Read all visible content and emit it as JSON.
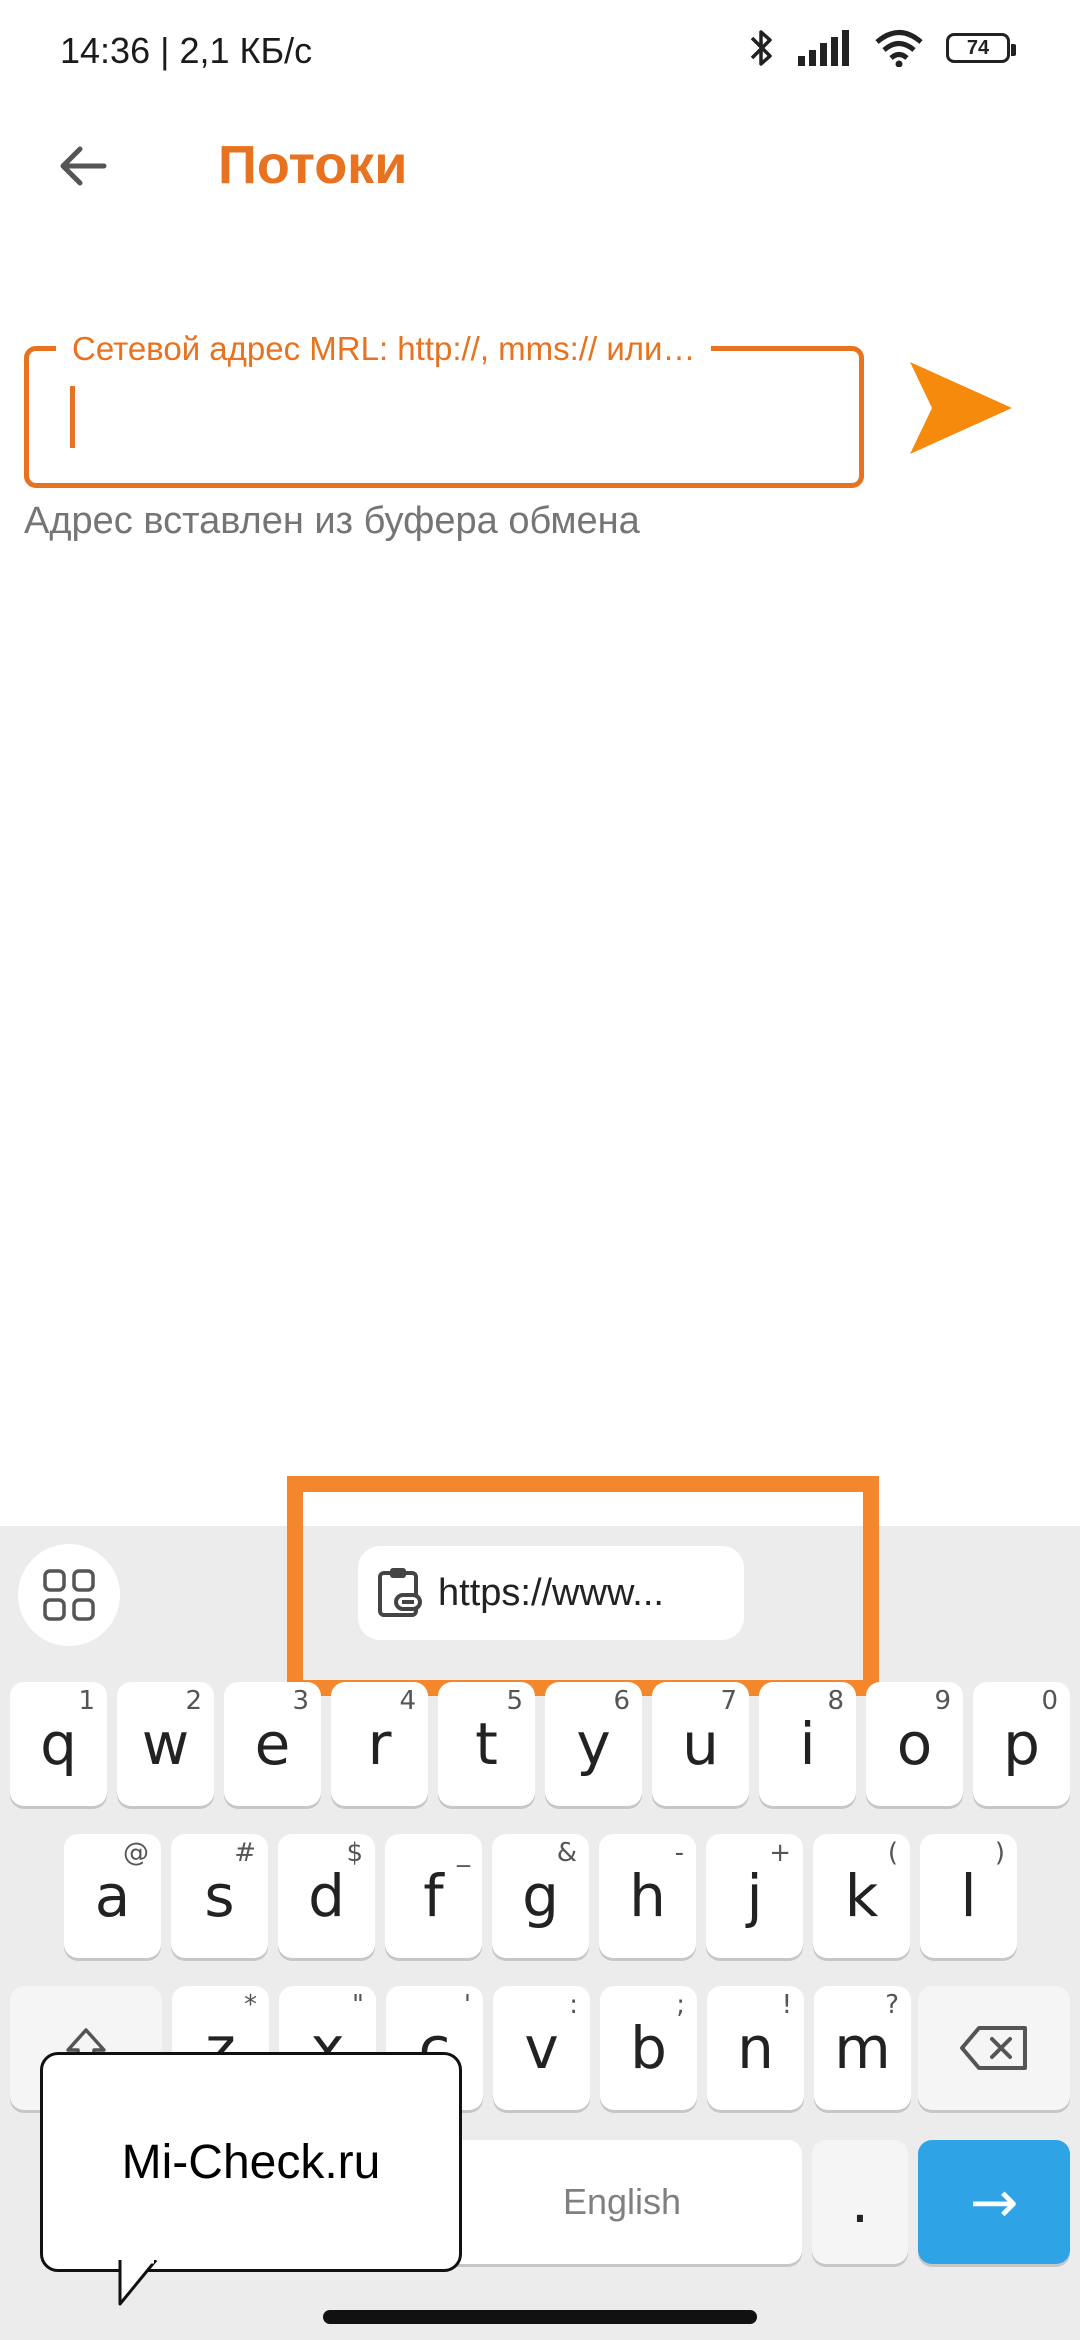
{
  "status_bar": {
    "time_speed": "14:36 | 2,1 КБ/с",
    "battery": "74"
  },
  "app_bar": {
    "title": "Потоки"
  },
  "input": {
    "label": "Сетевой адрес MRL: http://, mms:// или…",
    "hint": "Адрес вставлен из буфера обмена"
  },
  "suggestion": {
    "clipboard_text": "https://www..."
  },
  "keyboard": {
    "row1": [
      {
        "char": "q",
        "sup": "1"
      },
      {
        "char": "w",
        "sup": "2"
      },
      {
        "char": "e",
        "sup": "3"
      },
      {
        "char": "r",
        "sup": "4"
      },
      {
        "char": "t",
        "sup": "5"
      },
      {
        "char": "y",
        "sup": "6"
      },
      {
        "char": "u",
        "sup": "7"
      },
      {
        "char": "i",
        "sup": "8"
      },
      {
        "char": "o",
        "sup": "9"
      },
      {
        "char": "p",
        "sup": "0"
      }
    ],
    "row2": [
      {
        "char": "a",
        "sup": "@"
      },
      {
        "char": "s",
        "sup": "#"
      },
      {
        "char": "d",
        "sup": "$"
      },
      {
        "char": "f",
        "sup": "_"
      },
      {
        "char": "g",
        "sup": "&"
      },
      {
        "char": "h",
        "sup": "-"
      },
      {
        "char": "j",
        "sup": "+"
      },
      {
        "char": "k",
        "sup": "("
      },
      {
        "char": "l",
        "sup": ")"
      }
    ],
    "row3": [
      {
        "char": "z",
        "sup": "*"
      },
      {
        "char": "x",
        "sup": "\""
      },
      {
        "char": "c",
        "sup": "'"
      },
      {
        "char": "v",
        "sup": ":"
      },
      {
        "char": "b",
        "sup": ";"
      },
      {
        "char": "n",
        "sup": "!"
      },
      {
        "char": "m",
        "sup": "?"
      }
    ],
    "space_label": "English",
    "period": ".",
    "enter_symbol": "→"
  },
  "watermark": {
    "text": "Mi-Check.ru"
  },
  "colors": {
    "accent": "#e8721f",
    "highlight": "#f4862c",
    "enter_key": "#2ea3e5"
  }
}
